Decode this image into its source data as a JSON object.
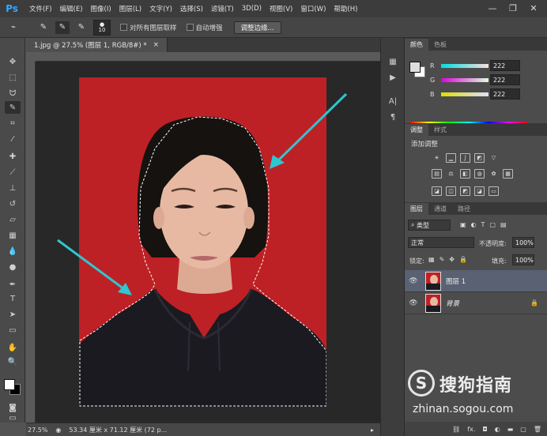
{
  "app": {
    "logo": "Ps"
  },
  "menu": [
    "文件(F)",
    "编辑(E)",
    "图像(I)",
    "图层(L)",
    "文字(Y)",
    "选择(S)",
    "滤镜(T)",
    "3D(D)",
    "视图(V)",
    "窗口(W)",
    "帮助(H)"
  ],
  "window_controls": {
    "minimize": "—",
    "restore": "❐",
    "close": "✕"
  },
  "options": {
    "brush_size": "10",
    "sample_all_layers": "对所有图层取样",
    "auto_enhance": "自动增强",
    "refine_edge": "调整边缘..."
  },
  "document": {
    "tab_title": "1.jpg @ 27.5% (图层 1, RGB/8#) *",
    "tab_close": "×",
    "zoom": "27.5%",
    "doc_info": "53.34 厘米 x 71.12 厘米 (72 p...",
    "image_colors": {
      "background": "#bd2125",
      "hair": "#15120f",
      "skin": "#e7b9a3",
      "hoodie": "#1b1a20"
    }
  },
  "color_panel": {
    "tabs": [
      "颜色",
      "色板"
    ],
    "channels": [
      {
        "label": "R",
        "value": "222"
      },
      {
        "label": "G",
        "value": "222"
      },
      {
        "label": "B",
        "value": "222"
      }
    ]
  },
  "adjustments_panel": {
    "tabs": [
      "调整",
      "样式"
    ],
    "title": "添加调整"
  },
  "layers_panel": {
    "tabs": [
      "图层",
      "通道",
      "路径"
    ],
    "filter_kind": "类型",
    "blend_mode": "正常",
    "opacity_label": "不透明度:",
    "opacity_value": "100%",
    "lock_label": "锁定:",
    "fill_label": "填充:",
    "fill_value": "100%",
    "layers": [
      {
        "name": "图层 1",
        "selected": true
      },
      {
        "name": "背景",
        "selected": false,
        "locked": true
      }
    ],
    "footer_icons": [
      "link-icon",
      "fx-icon",
      "mask-icon",
      "adjustment-icon",
      "folder-icon",
      "new-layer-icon",
      "trash-icon"
    ],
    "footer_labels": {
      "fx": "fx."
    }
  },
  "watermark": {
    "brand": "搜狗指南",
    "url": "zhinan.sogou.com"
  },
  "accent_colors": {
    "ps_blue": "#31a8ff",
    "arrow": "#2ec6d0",
    "selected_layer": "#596173"
  }
}
